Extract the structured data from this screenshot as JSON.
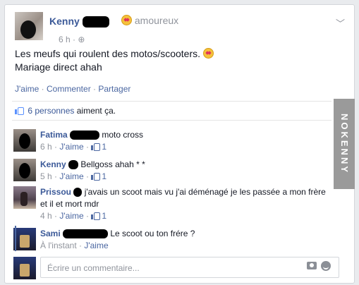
{
  "post": {
    "author": "Kenny",
    "feeling": "amoureux",
    "time": "6 h",
    "text_line1": "Les meufs qui roulent des motos/scooters.",
    "text_line2": "Mariage direct ahah",
    "actions": {
      "like": "J'aime",
      "comment": "Commenter",
      "share": "Partager",
      "separator": "·"
    },
    "likes_count": "6 personnes",
    "likes_suffix": "aiment ça."
  },
  "comments": [
    {
      "author": "Fatima",
      "text": "moto cross",
      "time": "6 h",
      "like_label": "J'aime",
      "like_count": "1"
    },
    {
      "author": "Kenny",
      "text": "Bellgoss ahah * *",
      "time": "5 h",
      "like_label": "J'aime",
      "like_count": "1"
    },
    {
      "author": "Prissou",
      "text_line1": "j'avais un scoot mais vu j'ai déménagé je les passée a mon frère",
      "text_line2": "et il et mort mdr",
      "time": "4 h",
      "like_label": "J'aime",
      "like_count": "1"
    },
    {
      "author": "Sami",
      "text": "Le scoot ou ton frére ?",
      "time": "À l'instant",
      "like_label": "J'aime"
    }
  ],
  "composer": {
    "placeholder": "Écrire un commentaire..."
  },
  "watermark": "NOKENNY",
  "colors": {
    "link": "#3b5998",
    "muted": "#90949c",
    "like_blue": "#5890ff"
  }
}
